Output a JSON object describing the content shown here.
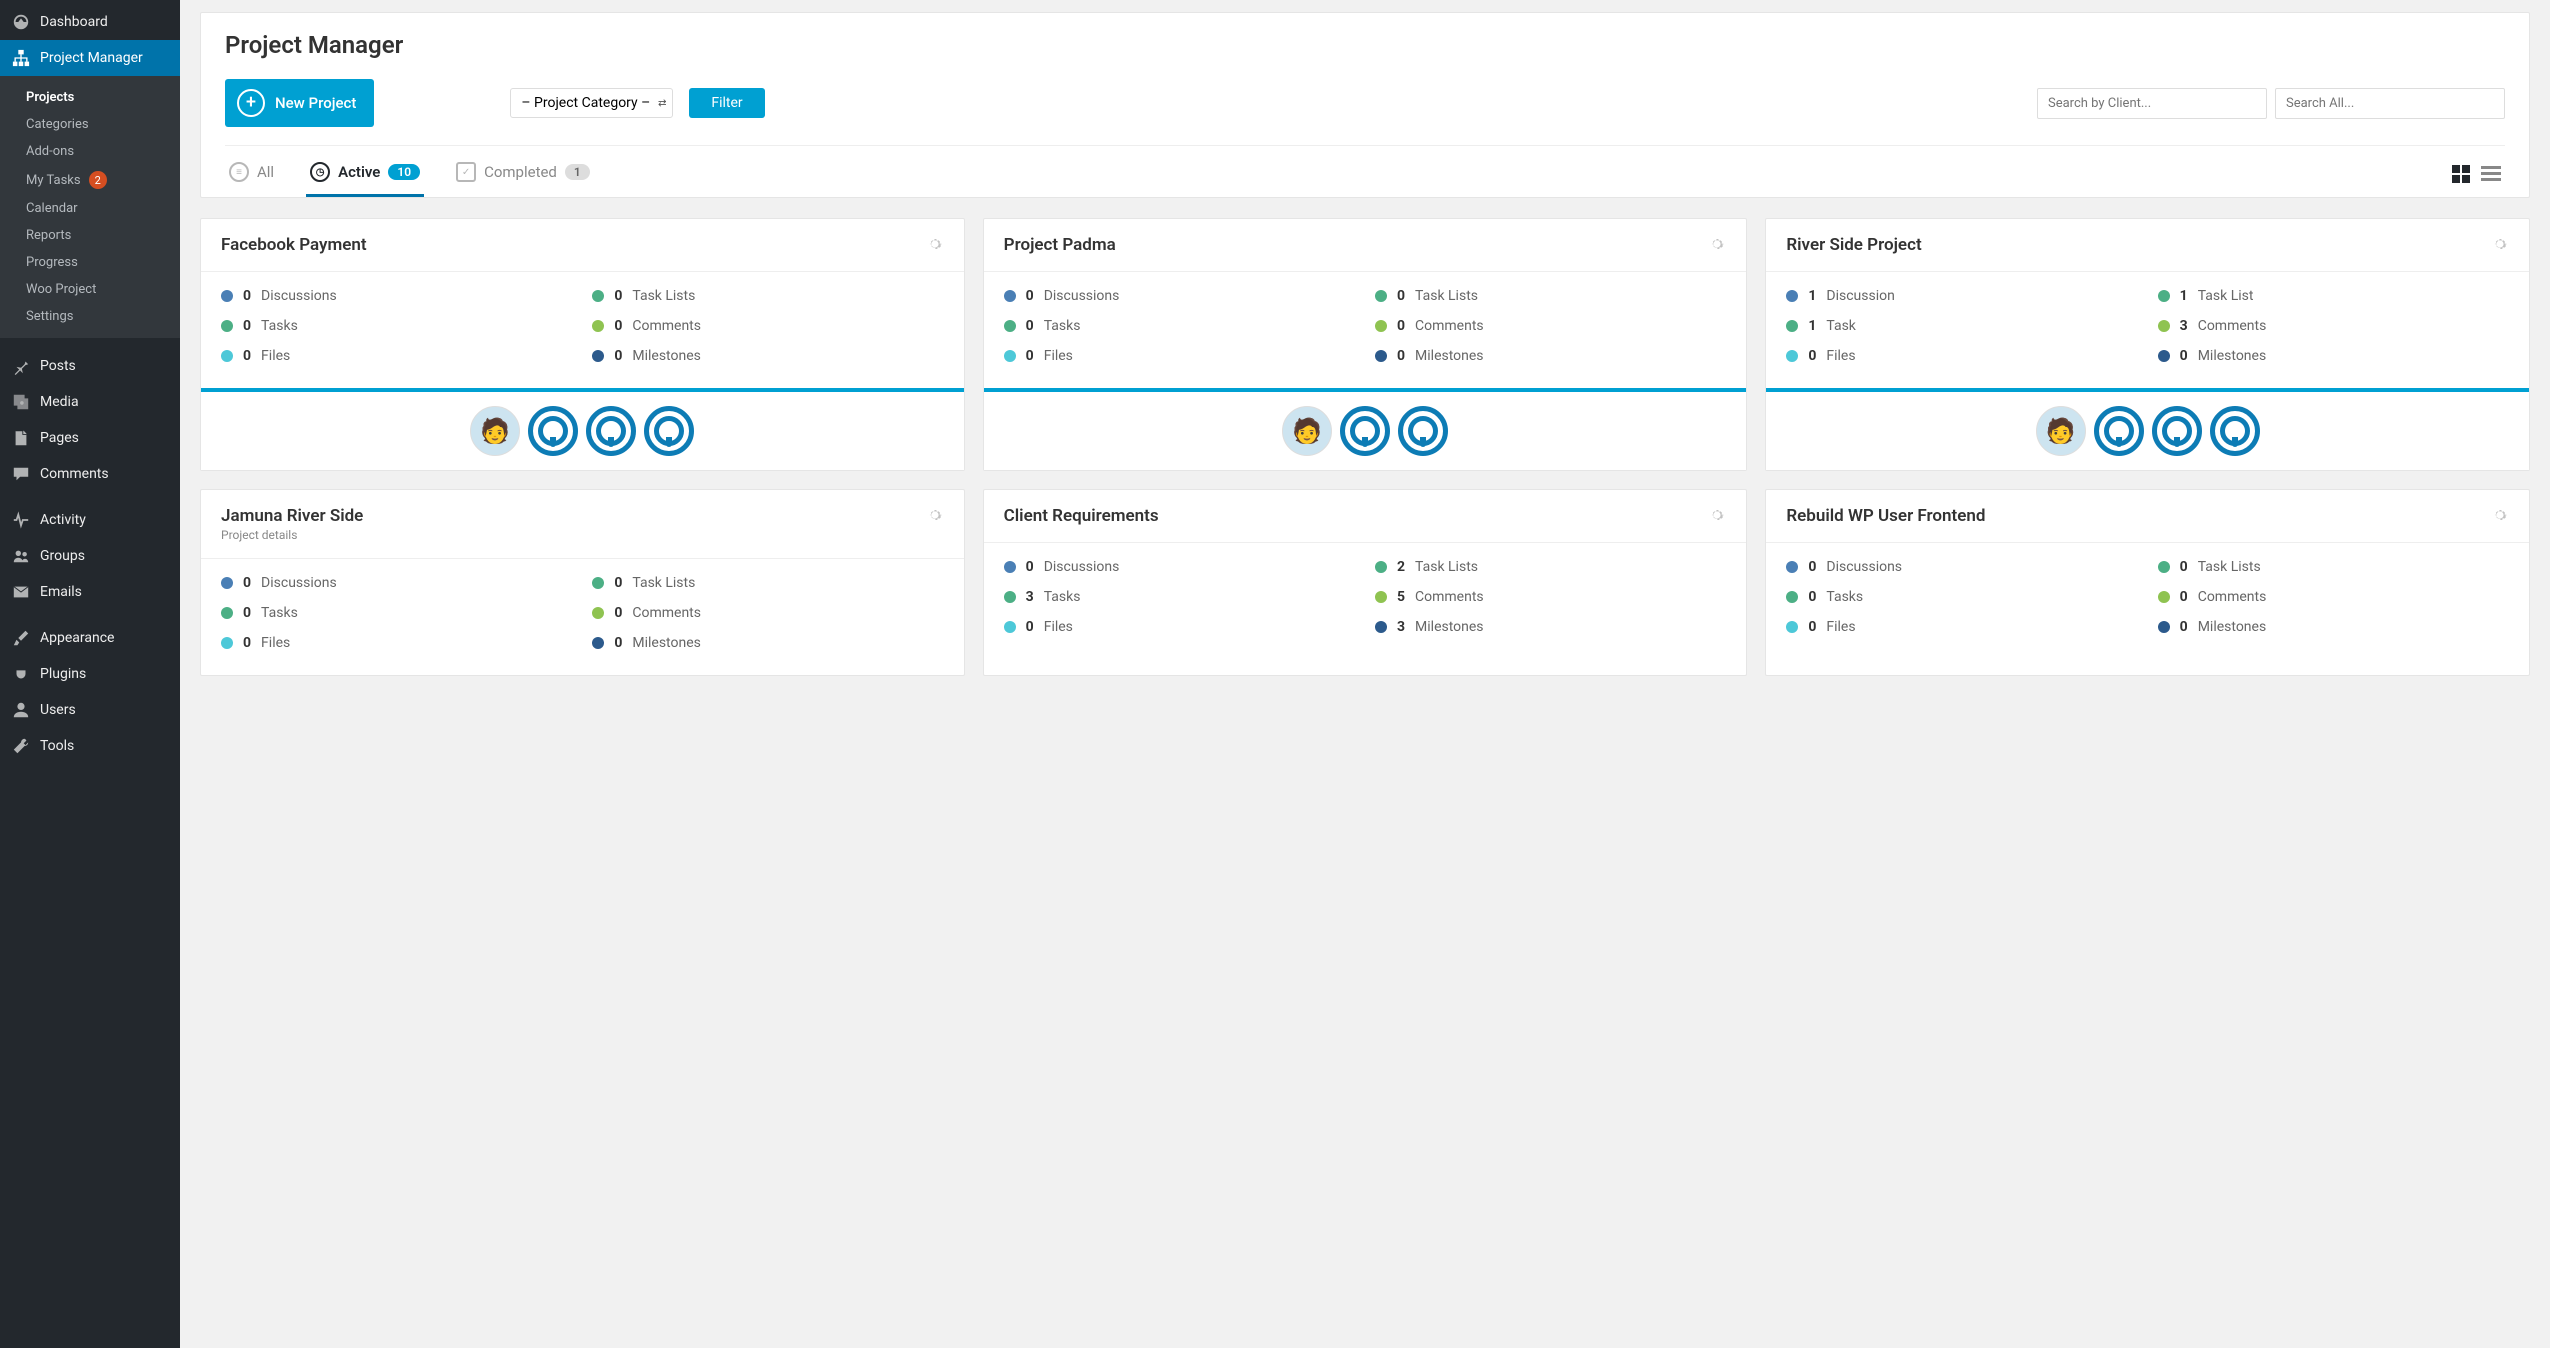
{
  "sidebar": {
    "main": [
      {
        "label": "Dashboard",
        "icon": "dashboard-icon"
      },
      {
        "label": "Project Manager",
        "icon": "sitemap-icon",
        "active": true
      }
    ],
    "sub": [
      {
        "label": "Projects",
        "current": true
      },
      {
        "label": "Categories"
      },
      {
        "label": "Add-ons"
      },
      {
        "label": "My Tasks",
        "badge": "2"
      },
      {
        "label": "Calendar"
      },
      {
        "label": "Reports"
      },
      {
        "label": "Progress"
      },
      {
        "label": "Woo Project"
      },
      {
        "label": "Settings"
      }
    ],
    "wp": [
      {
        "label": "Posts",
        "icon": "pin-icon"
      },
      {
        "label": "Media",
        "icon": "media-icon"
      },
      {
        "label": "Pages",
        "icon": "page-icon"
      },
      {
        "label": "Comments",
        "icon": "comment-icon"
      }
    ],
    "wp2": [
      {
        "label": "Activity",
        "icon": "activity-icon"
      },
      {
        "label": "Groups",
        "icon": "groups-icon"
      },
      {
        "label": "Emails",
        "icon": "mail-icon"
      }
    ],
    "wp3": [
      {
        "label": "Appearance",
        "icon": "brush-icon"
      },
      {
        "label": "Plugins",
        "icon": "plug-icon"
      },
      {
        "label": "Users",
        "icon": "user-icon"
      },
      {
        "label": "Tools",
        "icon": "wrench-icon"
      }
    ]
  },
  "header": {
    "title": "Project Manager",
    "new_project": "New Project",
    "category_placeholder": "– Project Category –",
    "filter": "Filter",
    "search_client_ph": "Search by Client...",
    "search_all_ph": "Search All..."
  },
  "tabs": {
    "all": "All",
    "active": "Active",
    "active_count": "10",
    "completed": "Completed",
    "completed_count": "1"
  },
  "stat_labels": {
    "discussions": "Discussions",
    "discussion": "Discussion",
    "tasklists": "Task Lists",
    "tasklist": "Task List",
    "tasks": "Tasks",
    "task": "Task",
    "comments": "Comments",
    "files": "Files",
    "milestones": "Milestones"
  },
  "projects": [
    {
      "title": "Facebook Payment",
      "discussions": "0",
      "tasklists": "0",
      "tasks": "0",
      "comments": "0",
      "files": "0",
      "milestones": "0",
      "avatars": 4,
      "show_foot": true
    },
    {
      "title": "Project Padma",
      "discussions": "0",
      "tasklists": "0",
      "tasks": "0",
      "comments": "0",
      "files": "0",
      "milestones": "0",
      "avatars": 3,
      "show_foot": true
    },
    {
      "title": "River Side Project",
      "discussions": "1",
      "discussion_single": true,
      "tasklists": "1",
      "tasklist_single": true,
      "tasks": "1",
      "task_single": true,
      "comments": "3",
      "files": "0",
      "milestones": "0",
      "avatars": 4,
      "show_foot": true
    },
    {
      "title": "Jamuna River Side",
      "subtitle": "Project details",
      "discussions": "0",
      "tasklists": "0",
      "tasks": "0",
      "comments": "0",
      "files": "0",
      "milestones": "0",
      "avatars": 0,
      "show_foot": false
    },
    {
      "title": "Client Requirements",
      "discussions": "0",
      "tasklists": "2",
      "tasks": "3",
      "comments": "5",
      "files": "0",
      "milestones": "3",
      "avatars": 0,
      "show_foot": false
    },
    {
      "title": "Rebuild WP User Frontend",
      "discussions": "0",
      "tasklists": "0",
      "tasks": "0",
      "comments": "0",
      "files": "0",
      "milestones": "0",
      "avatars": 0,
      "show_foot": false
    }
  ]
}
